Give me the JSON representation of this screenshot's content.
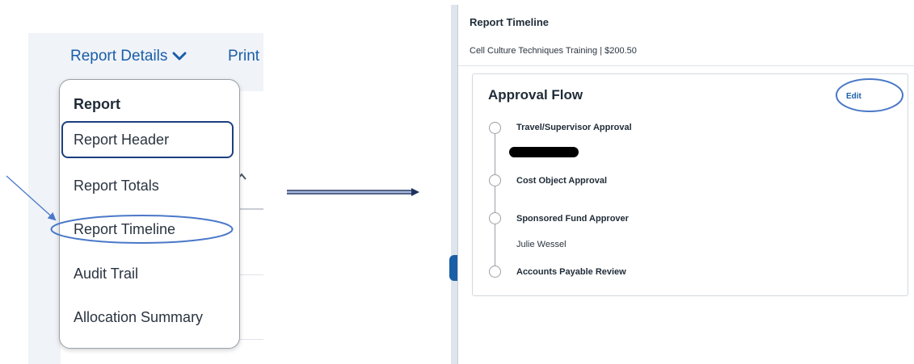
{
  "left": {
    "header": {
      "report_details_label": "Report Details",
      "print_label": "Print",
      "chevron_icon": "chevron-down-icon"
    },
    "menu": {
      "heading": "Report",
      "items": [
        {
          "label": "Report Header",
          "state": "focused"
        },
        {
          "label": "Report Totals"
        },
        {
          "label": "Report Timeline",
          "state": "circled"
        },
        {
          "label": "Audit Trail"
        },
        {
          "label": "Allocation Summary"
        }
      ]
    }
  },
  "right": {
    "dialog": {
      "title": "Report Timeline",
      "subtitle": "Cell Culture Techniques Training | $200.50"
    },
    "approval_flow": {
      "title": "Approval Flow",
      "edit_label": "Edit",
      "steps": [
        {
          "label": "Travel/Supervisor Approval",
          "person": "",
          "redacted": true
        },
        {
          "label": "Cost Object Approval",
          "person": ""
        },
        {
          "label": "Sponsored Fund Approver",
          "person": "Julie Wessel"
        },
        {
          "label": "Accounts Payable Review",
          "person": ""
        }
      ]
    }
  },
  "colors": {
    "link_blue": "#1a5ea8",
    "annotation_blue": "#4a78c8",
    "focus_border": "#1b3f80",
    "panel_bg": "#f0f3f8"
  }
}
